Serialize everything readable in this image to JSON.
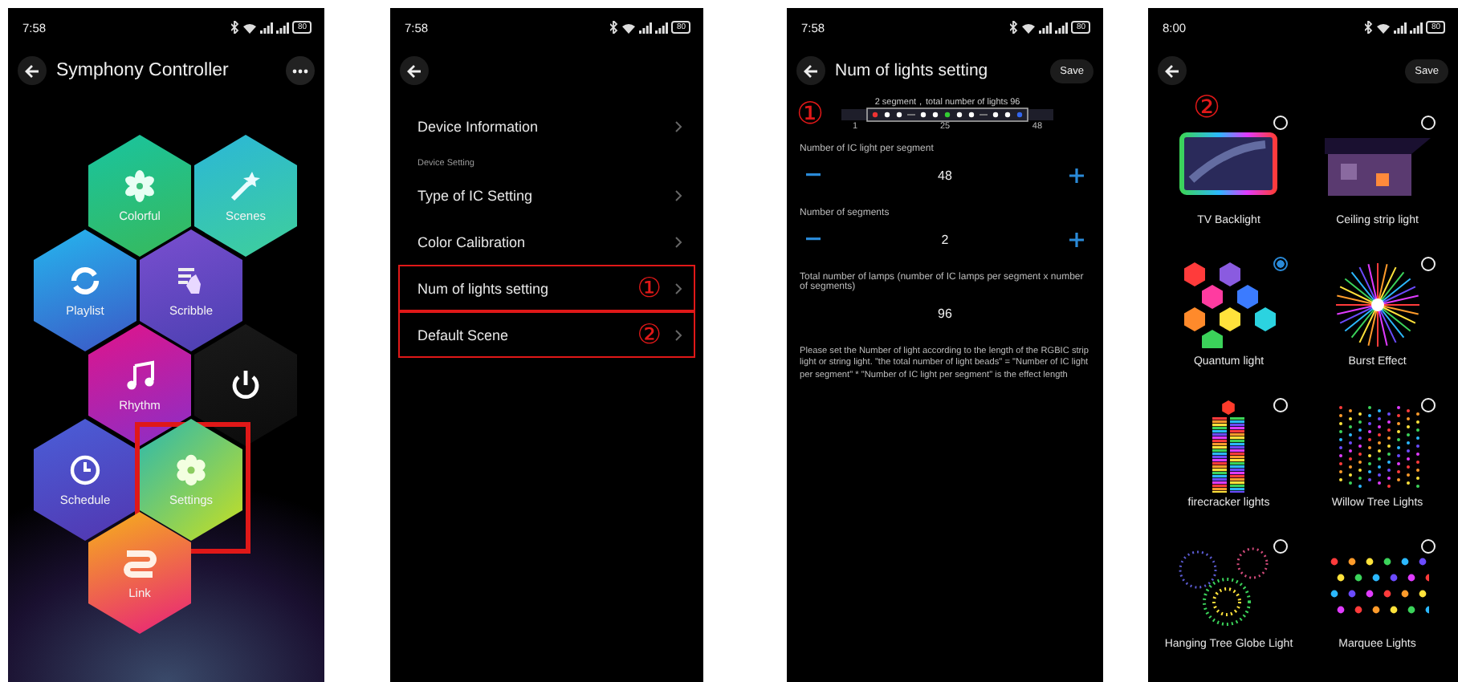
{
  "home_screen": {
    "status_bar": {
      "time": "7:58",
      "battery": "80"
    },
    "title": "Symphony Controller",
    "tiles": [
      {
        "kind": "colorful",
        "label": "Colorful",
        "highlighted": false
      },
      {
        "kind": "scenes",
        "label": "Scenes",
        "highlighted": false
      },
      {
        "kind": "playlist",
        "label": "Playlist",
        "highlighted": false
      },
      {
        "kind": "scribble",
        "label": "Scribble",
        "highlighted": false
      },
      {
        "kind": "rhythm",
        "label": "Rhythm",
        "highlighted": false
      },
      {
        "kind": "power",
        "highlighted": false
      },
      {
        "kind": "schedule",
        "label": "Schedule",
        "highlighted": false
      },
      {
        "kind": "settings",
        "label": "Settings",
        "highlighted": true
      },
      {
        "kind": "link",
        "label": "Link",
        "highlighted": false
      }
    ]
  },
  "settings_screen": {
    "status_bar": {
      "time": "7:58",
      "battery": "80"
    },
    "items": [
      {
        "kind": "item",
        "label": "Device Information",
        "highlighted": false
      },
      {
        "kind": "section",
        "label": "Device Setting"
      },
      {
        "kind": "item",
        "label": "Type of IC Setting",
        "highlighted": false
      },
      {
        "kind": "item",
        "label": "Color Calibration",
        "highlighted": false
      },
      {
        "kind": "item",
        "label": "Num of lights setting",
        "highlighted": true,
        "marker": "①"
      },
      {
        "kind": "item",
        "label": "Default Scene",
        "highlighted": true,
        "marker": "②"
      }
    ]
  },
  "lights_screen": {
    "status_bar": {
      "time": "7:58",
      "battery": "80"
    },
    "title": "Num of lights setting",
    "save": "Save",
    "marker": "①",
    "strip": {
      "caption": "2 segment，total number of lights 96",
      "ticks": [
        "1",
        "25",
        "48"
      ]
    },
    "steppers": [
      {
        "label": "Number of IC light per segment",
        "value": "48"
      },
      {
        "label": "Number of segments",
        "value": "2"
      }
    ],
    "total": {
      "label": "Total number of lamps (number of IC lamps per segment x number of segments)",
      "value": "96"
    },
    "note": "Please set the Number of light according to the length of the RGBIC strip light or string light. \"the total number of light beads\" = \"Number of IC light per segment\" * \"Number of IC light per segment\" is the effect length"
  },
  "scene_screen": {
    "status_bar": {
      "time": "8:00",
      "battery": "80"
    },
    "save": "Save",
    "marker": "②",
    "scenes": [
      {
        "kind": "tv",
        "label": "TV Backlight",
        "selected": false
      },
      {
        "kind": "ceiling",
        "label": "Ceiling strip light",
        "selected": false
      },
      {
        "kind": "quantum",
        "label": "Quantum light",
        "selected": true
      },
      {
        "kind": "burst",
        "label": "Burst Effect",
        "selected": false
      },
      {
        "kind": "firecracker",
        "label": "firecracker lights",
        "selected": false
      },
      {
        "kind": "willow",
        "label": "Willow Tree Lights",
        "selected": false
      },
      {
        "kind": "globe",
        "label": "Hanging Tree Globe Light",
        "selected": false
      },
      {
        "kind": "marquee",
        "label": "Marquee Lights",
        "selected": false
      }
    ]
  }
}
